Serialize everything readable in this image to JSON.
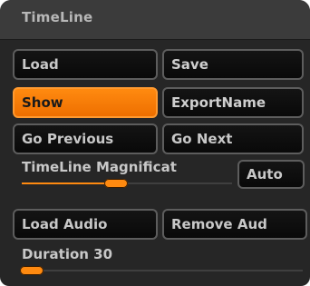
{
  "panel": {
    "title": "TimeLine"
  },
  "buttons": {
    "load": "Load",
    "save": "Save",
    "show": "Show",
    "export_name": "ExportName",
    "go_previous": "Go Previous",
    "go_next": "Go Next",
    "auto": "Auto",
    "load_audio": "Load Audio",
    "remove_audio": "Remove Aud"
  },
  "magnification": {
    "label": "TimeLine Magnificat",
    "value_fraction": 0.45
  },
  "duration": {
    "label": "Duration 30",
    "value": 30,
    "value_fraction": 0.02
  },
  "colors": {
    "accent": "#ff8a10",
    "panel_bg": "#262626",
    "button_border": "#5d5d5d"
  }
}
